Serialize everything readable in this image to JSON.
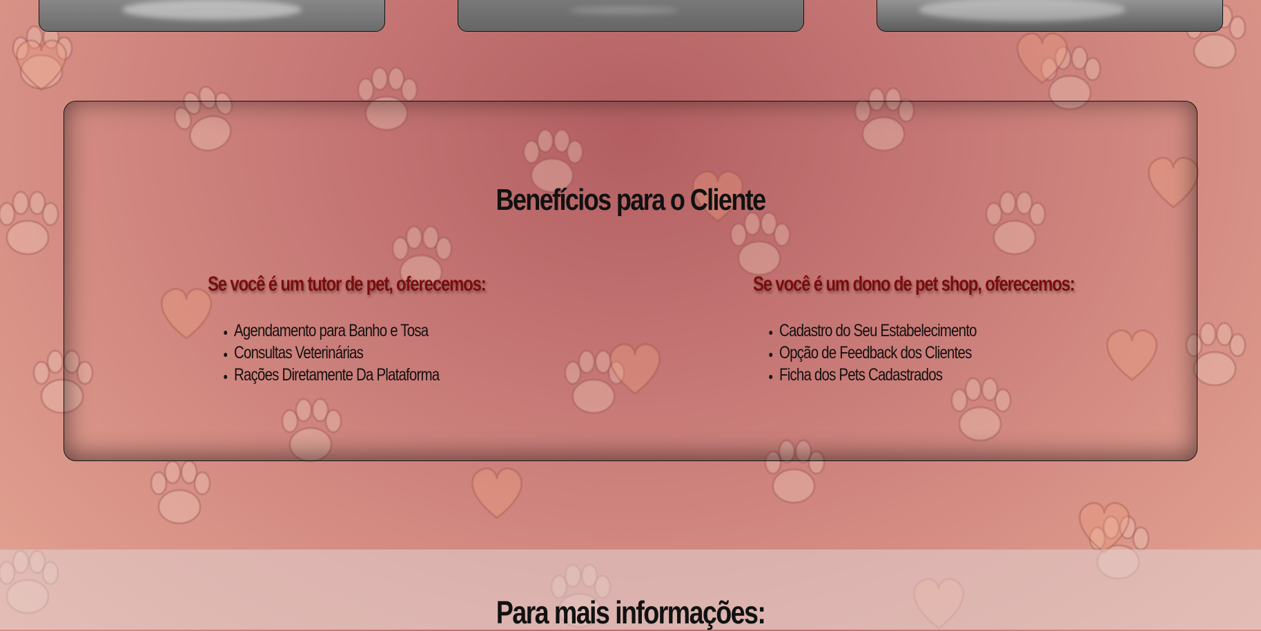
{
  "benefits": {
    "title": "Benefícios para o Cliente",
    "tutor": {
      "heading": "Se você é um tutor de pet, oferecemos:",
      "items": [
        "Agendamento para Banho e Tosa",
        "Consultas Veterinárias",
        "Rações Diretamente Da Plataforma"
      ]
    },
    "shop_owner": {
      "heading": "Se você é um dono de pet shop, oferecemos:",
      "items": [
        "Cadastro do Seu Estabelecimento",
        "Opção de Feedback dos Clientes",
        "Ficha dos Pets Cadastrados"
      ]
    }
  },
  "contact": {
    "title": "Para mais informações:"
  },
  "colors": {
    "accent_heading": "#7b0d0d",
    "background": "#c57775"
  },
  "icons": [
    "paw-icon",
    "heart-icon"
  ]
}
